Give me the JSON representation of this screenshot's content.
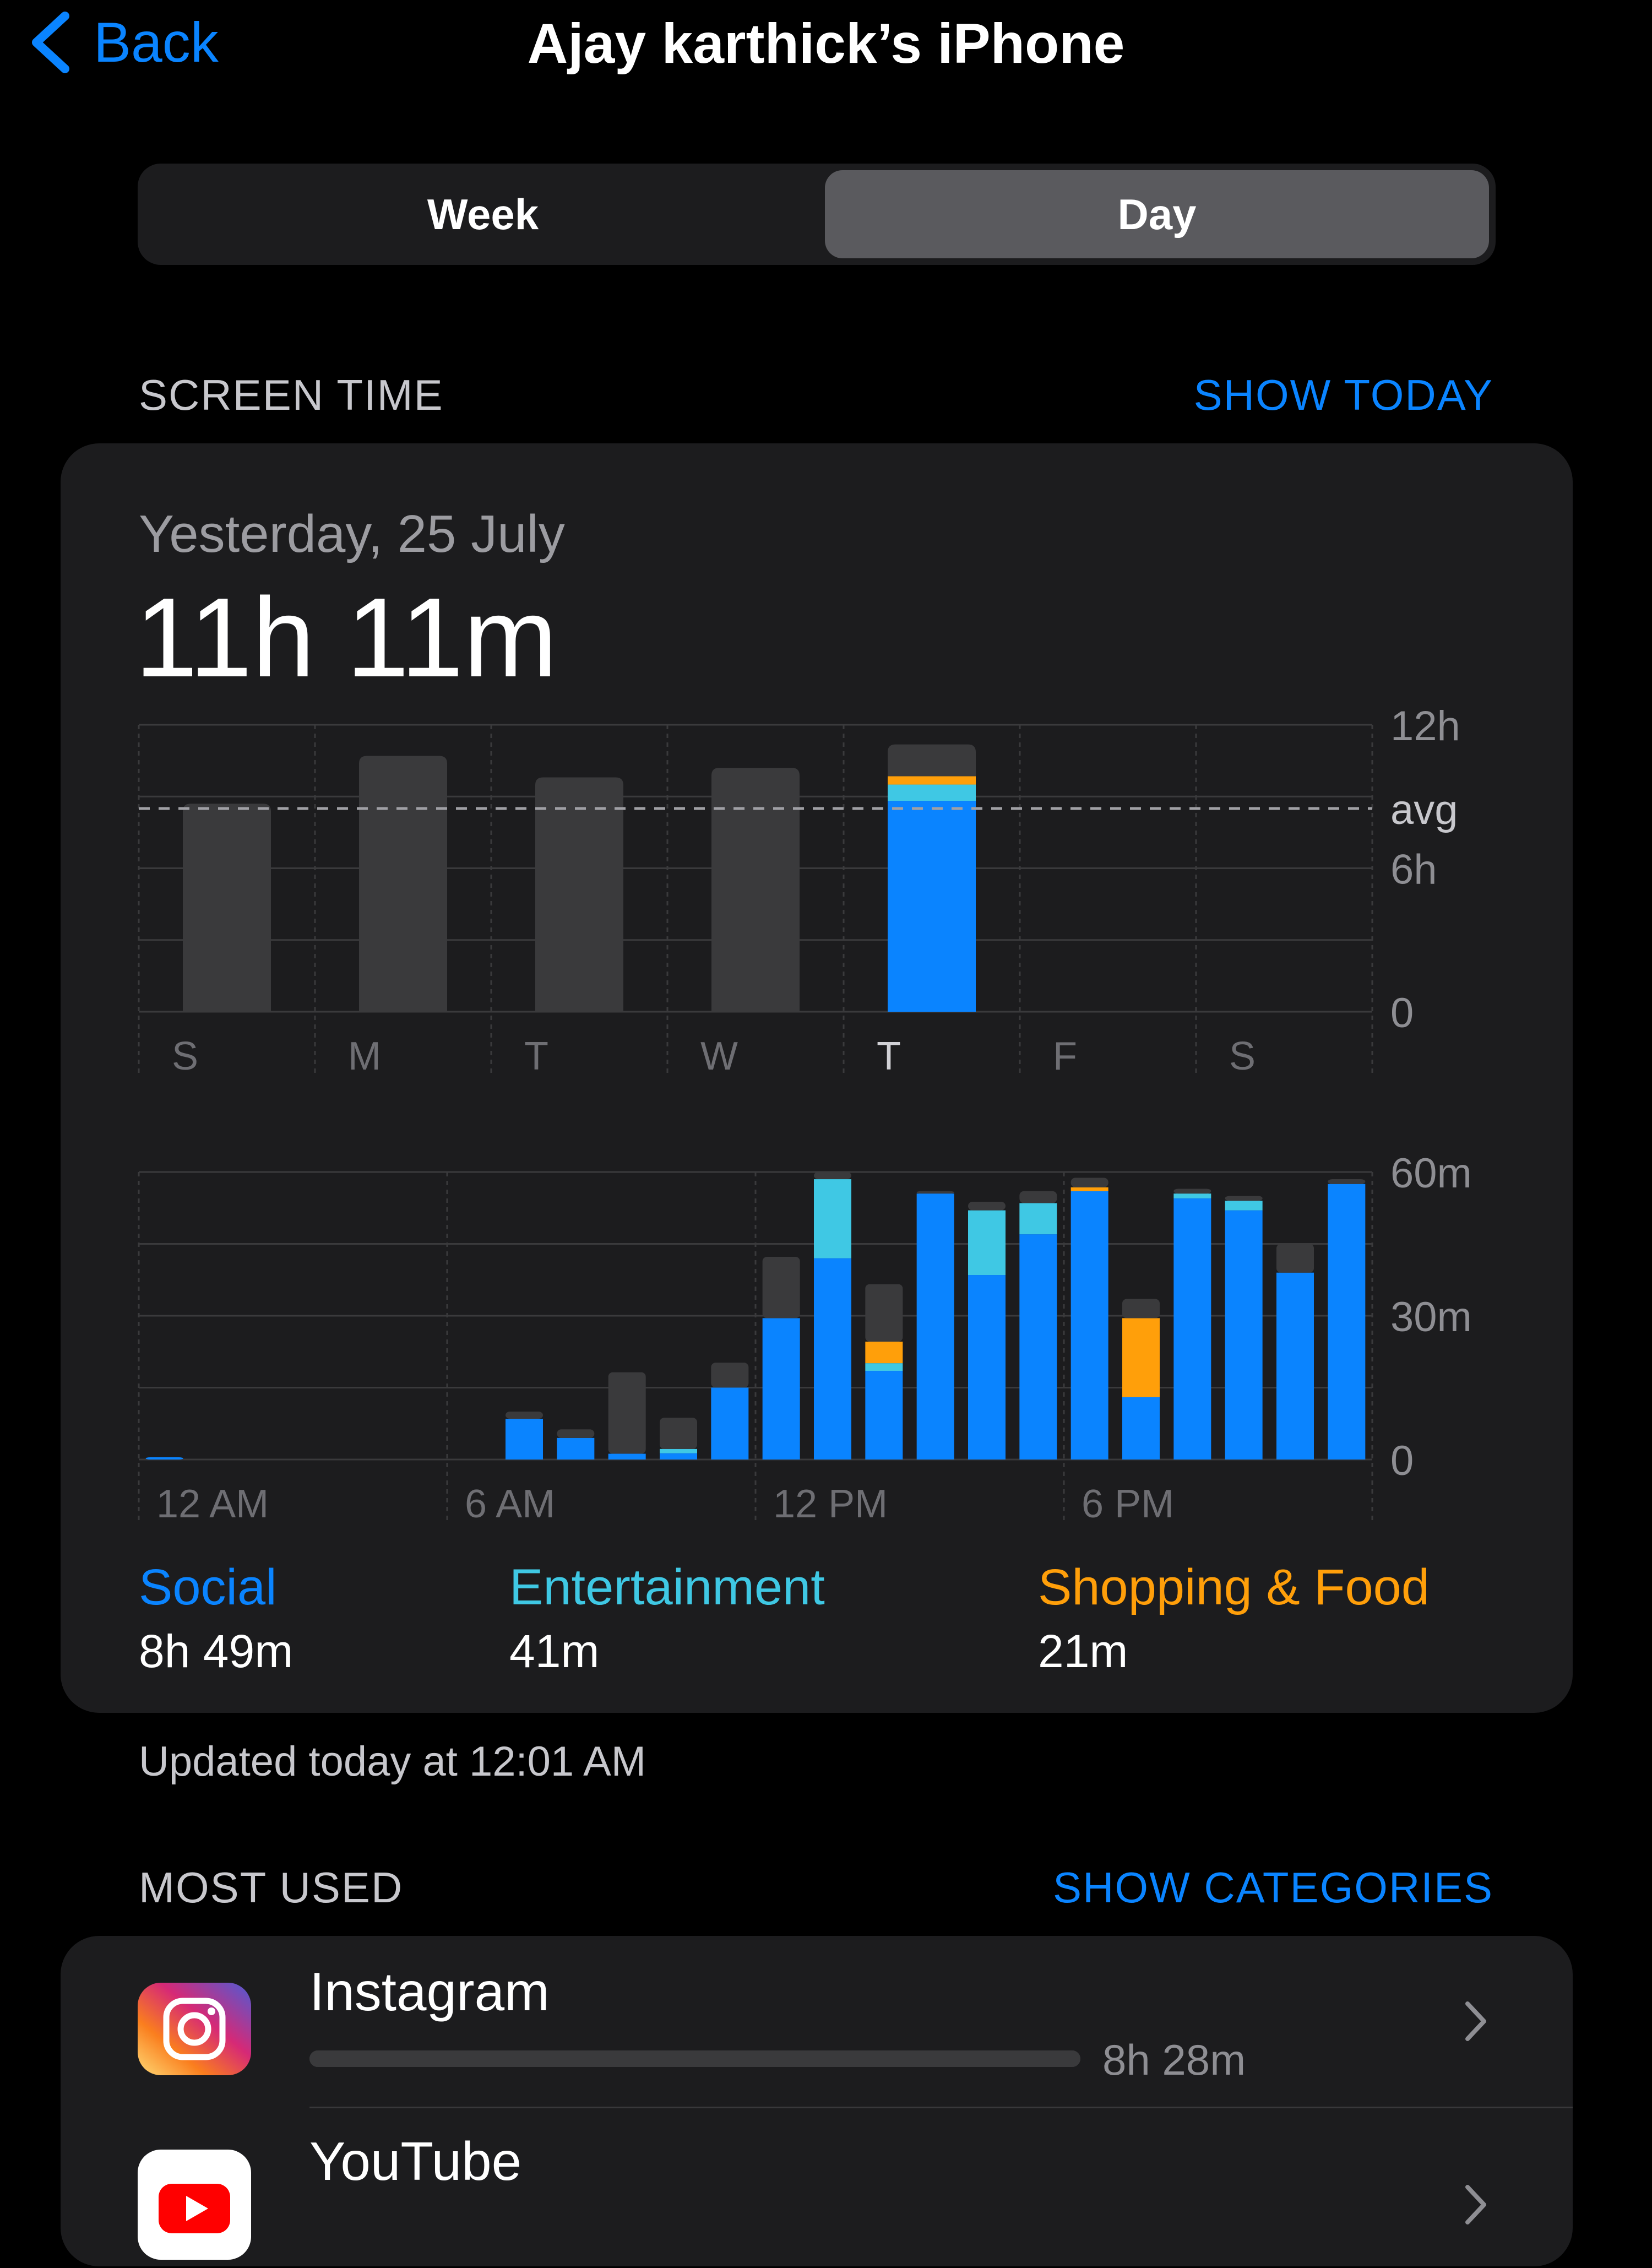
{
  "nav": {
    "back_label": "Back",
    "title": "Ajay karthick’s iPhone"
  },
  "segments": {
    "week": "Week",
    "day": "Day",
    "selected": "Day"
  },
  "screen_time": {
    "header": "SCREEN TIME",
    "link": "SHOW TODAY",
    "date": "Yesterday, 25 July",
    "total": "11h 11m"
  },
  "colors": {
    "social": "#0a84ff",
    "entertainment": "#3fc8e4",
    "shopping": "#ff9f0a",
    "other": "#3a3a3c",
    "link": "#0a84ff"
  },
  "chart_data": [
    {
      "type": "bar",
      "categories": [
        "S",
        "M",
        "T",
        "W",
        "T",
        "F",
        "S"
      ],
      "y_ticks": [
        "12h",
        "avg",
        "6h",
        "0"
      ],
      "ylim": [
        0,
        12
      ],
      "avg": 8.5,
      "selected_index": 4,
      "series": [
        {
          "name": "Social",
          "values": [
            0,
            0,
            0,
            0,
            8.82
          ]
        },
        {
          "name": "Entertainment",
          "values": [
            0,
            0,
            0,
            0,
            0.68
          ]
        },
        {
          "name": "Shopping & Food",
          "values": [
            0,
            0,
            0,
            0,
            0.35
          ]
        },
        {
          "name": "Other",
          "values": [
            8.7,
            10.7,
            9.8,
            10.2,
            1.33
          ]
        }
      ]
    },
    {
      "type": "bar",
      "x_labels": [
        "12 AM",
        "6 AM",
        "12 PM",
        "6 PM"
      ],
      "y_ticks": [
        "60m",
        "30m",
        "0"
      ],
      "ylim": [
        0,
        60
      ],
      "categories": [
        "0",
        "1",
        "2",
        "3",
        "4",
        "5",
        "6",
        "7",
        "8",
        "9",
        "10",
        "11",
        "12",
        "13",
        "14",
        "15",
        "16",
        "17",
        "18",
        "19",
        "20",
        "21",
        "22",
        "23"
      ],
      "series": [
        {
          "name": "Social",
          "values": [
            0.3,
            0,
            0,
            0,
            0,
            0,
            0,
            8.5,
            4.5,
            1.2,
            1.3,
            15,
            29.5,
            42,
            18.5,
            55.5,
            38.5,
            47,
            56,
            13,
            54.5,
            52,
            39,
            57.5
          ]
        },
        {
          "name": "Entertainment",
          "values": [
            0,
            0,
            0,
            0,
            0,
            0,
            0,
            0,
            0,
            0,
            0.9,
            0,
            0,
            16.5,
            1.6,
            0,
            13.5,
            6.5,
            0,
            0,
            1,
            2,
            0,
            0
          ]
        },
        {
          "name": "Shopping & Food",
          "values": [
            0,
            0,
            0,
            0,
            0,
            0,
            0,
            0,
            0,
            0,
            0,
            0,
            0,
            0,
            4.5,
            0,
            0,
            0,
            0.8,
            16.5,
            0,
            0,
            0,
            0
          ]
        },
        {
          "name": "Other",
          "values": [
            0,
            0,
            0,
            0,
            0,
            0,
            0,
            1.5,
            1.8,
            17,
            6.5,
            5.2,
            12.8,
            1.5,
            12,
            0.5,
            1.8,
            2.5,
            2,
            4,
            1,
            1,
            6,
            1
          ]
        }
      ]
    }
  ],
  "categories_summary": [
    {
      "name": "Social",
      "value": "8h 49m"
    },
    {
      "name": "Entertainment",
      "value": "41m"
    },
    {
      "name": "Shopping & Food",
      "value": "21m"
    }
  ],
  "updated": "Updated today at 12:01 AM",
  "most_used": {
    "header": "MOST USED",
    "link": "SHOW CATEGORIES",
    "apps": [
      {
        "name": "Instagram",
        "time": "8h 28m",
        "icon": "instagram-icon",
        "fraction": 1.0
      },
      {
        "name": "YouTube",
        "time": "",
        "icon": "youtube-icon",
        "fraction": 0.05
      }
    ]
  }
}
